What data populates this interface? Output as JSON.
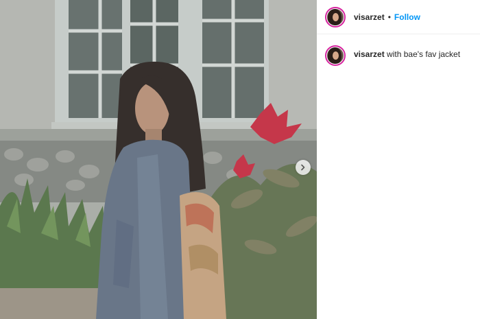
{
  "post": {
    "username": "visarzet",
    "separator": "•",
    "follow_label": "Follow",
    "caption_username": "visarzet",
    "caption_text": "with bae's fav jacket"
  },
  "icons": {
    "next": "chevron-right-icon",
    "avatar": "profile-avatar"
  },
  "colors": {
    "follow": "#0095f6",
    "story_ring": "#d6249f",
    "username": "#262626"
  }
}
